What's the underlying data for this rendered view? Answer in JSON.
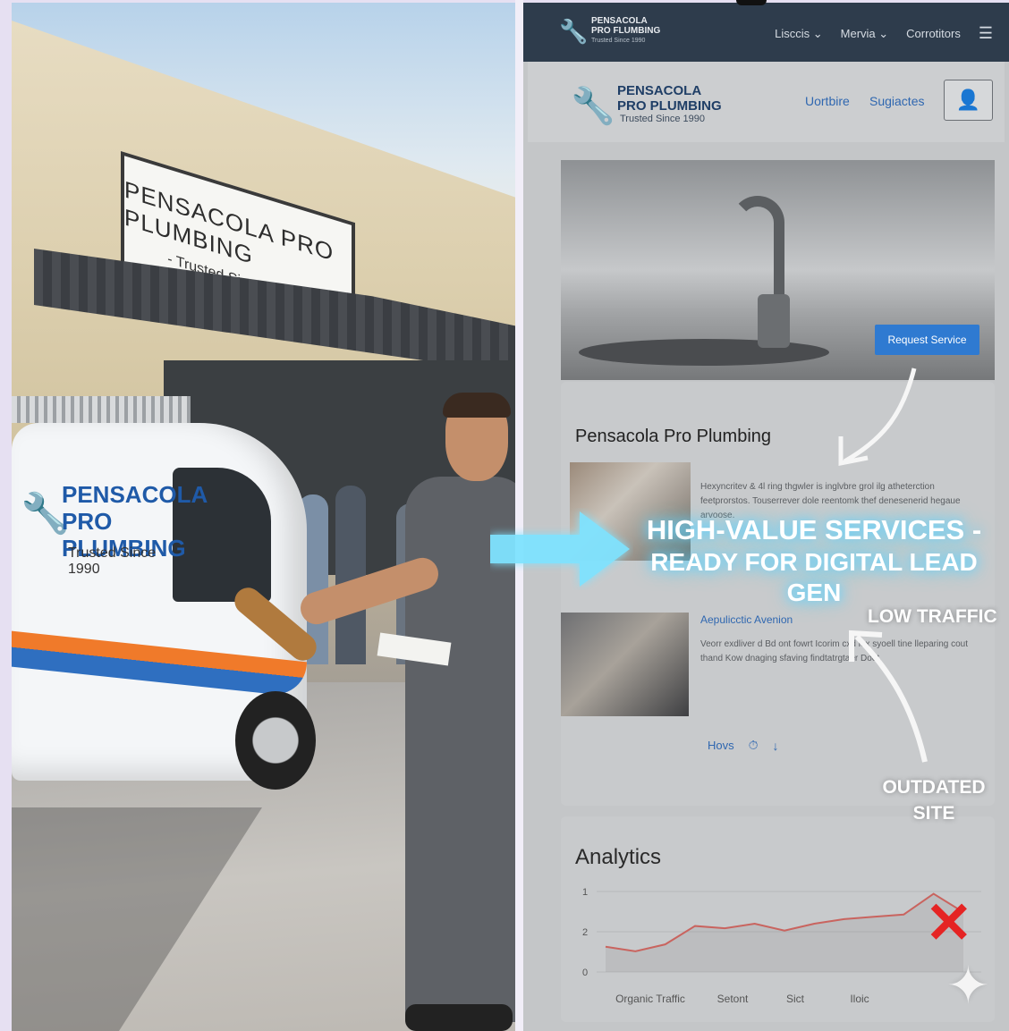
{
  "photo": {
    "storefront_sign_line1": "PENSACOLA PRO PLUMBING",
    "storefront_sign_line2": "- Trusted Since 1990 -",
    "van_brand_line1": "PENSACOLA",
    "van_brand_line2": "PRO PLUMBING",
    "van_tagline": "Trusted Since 1990"
  },
  "topnav": {
    "brand_line1": "PENSACOLA PRO FLUMBING",
    "brand_line2": "Trusted Since 1990",
    "links": [
      "Lisccis ⌄",
      "Mervia ⌄",
      "Corrotitors"
    ],
    "menu_icon": "hamburger-icon"
  },
  "header": {
    "logo_line1": "PENSACOLA PRO PLUMBING",
    "logo_line2": "Trusted Since 1990",
    "link1": "Uortbire",
    "link2": "Sugiactes",
    "user_icon": "user-icon"
  },
  "hero": {
    "cta": "Request Service"
  },
  "content": {
    "title": "Pensacola Pro Plumbing",
    "item1_desc": "Hexyncritev & 4l ring thgwler is inglvbre grol ilg atheterction feetprorstos. Touserrever dole reentomk thef denesenerid hegaue arvoose.",
    "item2_title": "Aepulicctic Avenion",
    "item2_desc": "Veorr exdliver d Bd ont fowrt Icorim cxd lox syoell tine lleparing cout thand Kow dnaging sfaving findtatrgtaer Doet.",
    "footer_link": "Hovs",
    "footer_icons": [
      "timer-icon",
      "download-icon"
    ]
  },
  "analytics": {
    "title": "Analytics"
  },
  "overlay": {
    "headline_line1": "HIGH-VALUE SERVICES -",
    "headline_line2": "READY FOR DIGITAL LEAD GEN",
    "callout_low_traffic": "LOW TRAFFIC",
    "callout_outdated": "OUTDATED SITE",
    "accent_color": "#5fd3ff",
    "alert_color": "#e52424"
  },
  "chart_data": {
    "type": "line",
    "title": "Analytics",
    "y_ticks": [
      "1",
      "2",
      "0"
    ],
    "x_tick_labels": [
      "Organic Traffic",
      "Setont",
      "Sict",
      "Iloic"
    ],
    "series": [
      {
        "values": [
          1.1,
          0.9,
          1.2,
          2.0,
          1.9,
          2.1,
          1.8,
          2.1,
          2.3,
          2.4,
          2.5,
          3.4,
          2.6
        ]
      }
    ],
    "line_color": "#c9645f"
  }
}
